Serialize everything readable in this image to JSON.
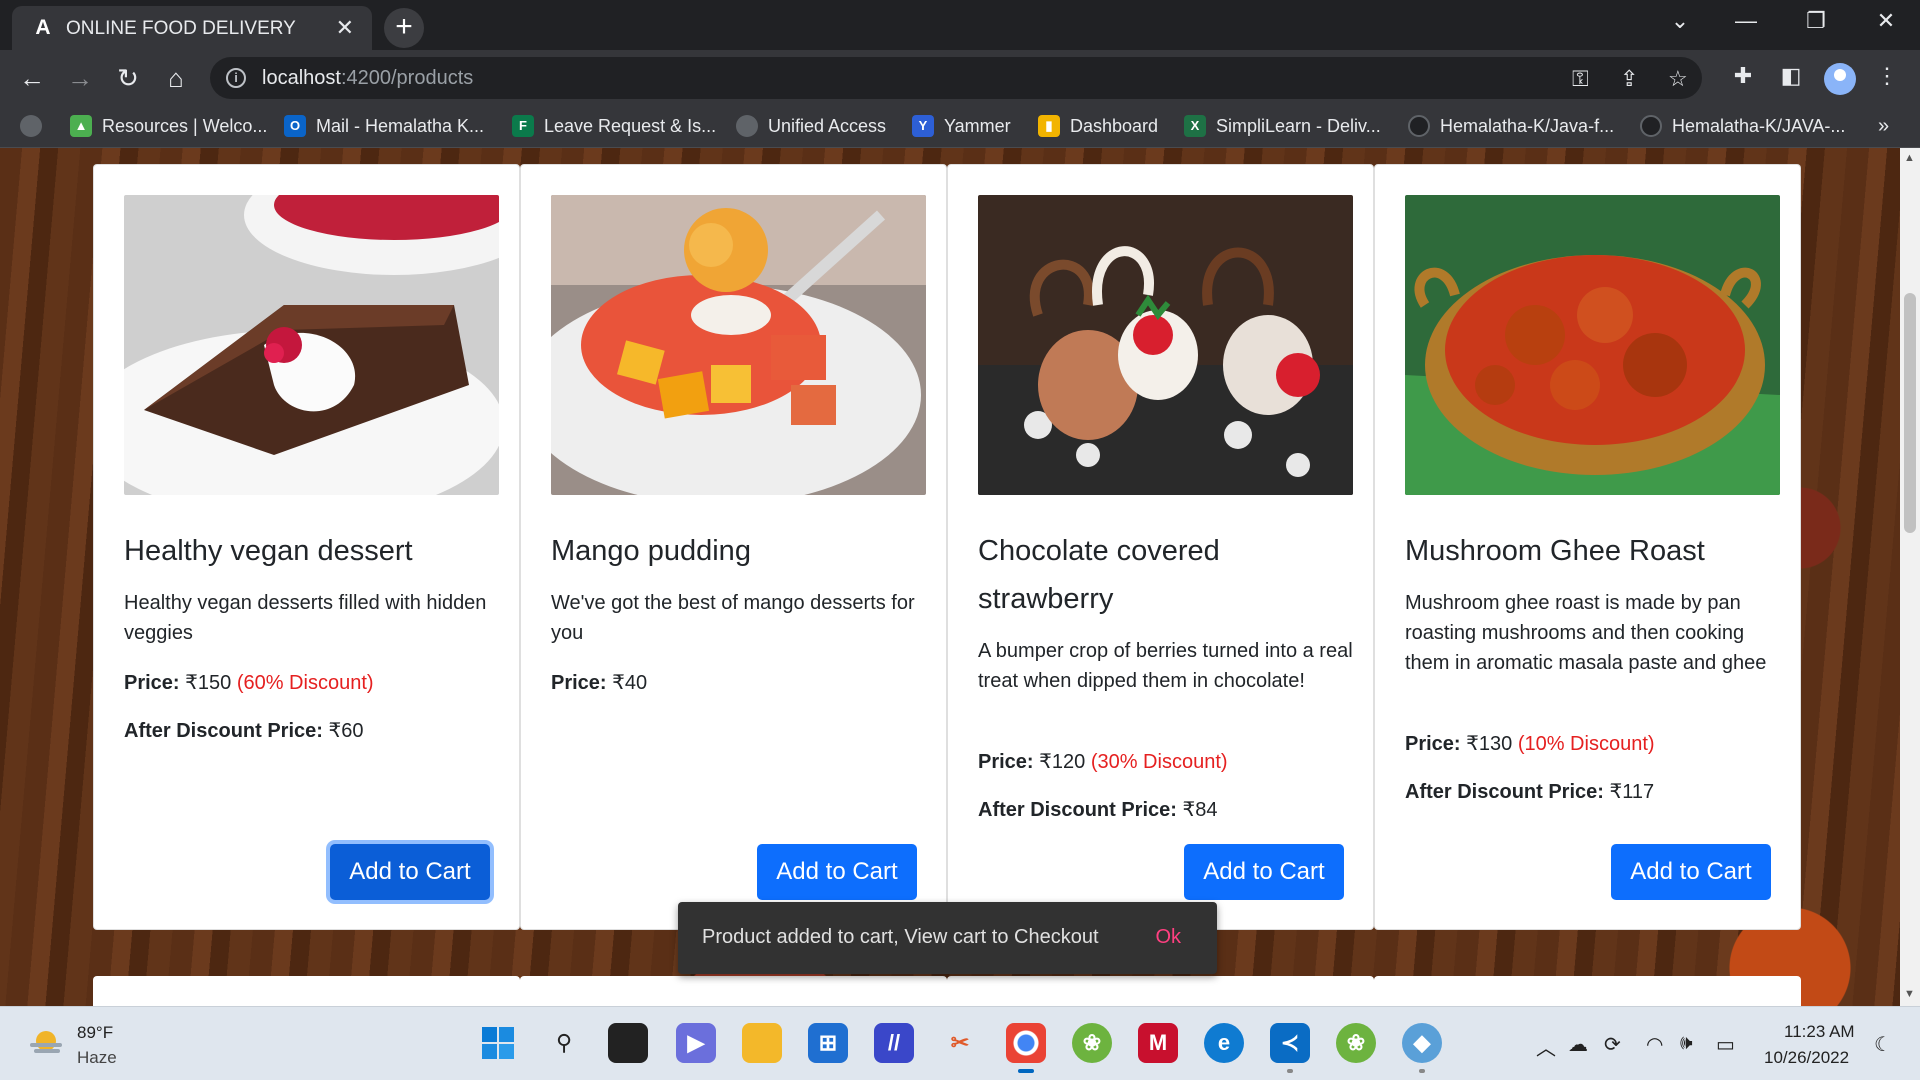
{
  "browser": {
    "tab_title": "ONLINE FOOD DELIVERY",
    "url_host": "localhost",
    "url_path": ":4200/products"
  },
  "bookmarks": [
    {
      "label": "Resources | Welco...",
      "icon": "building-icon",
      "color": "#4caf50"
    },
    {
      "label": "Mail - Hemalatha K...",
      "icon": "outlook-icon",
      "color": "#0a64c8"
    },
    {
      "label": "Leave Request & Is...",
      "icon": "forms-icon",
      "color": "#0b7a4b"
    },
    {
      "label": "Unified Access",
      "icon": "globe-icon",
      "color": "#5f6368"
    },
    {
      "label": "Yammer",
      "icon": "yammer-icon",
      "color": "#2d5fd6"
    },
    {
      "label": "Dashboard",
      "icon": "chart-icon",
      "color": "#f2b400"
    },
    {
      "label": "SimpliLearn - Deliv...",
      "icon": "excel-icon",
      "color": "#1e7145"
    },
    {
      "label": "Hemalatha-K/Java-f...",
      "icon": "github-icon",
      "color": "#202124"
    },
    {
      "label": "Hemalatha-K/JAVA-...",
      "icon": "github-icon",
      "color": "#202124"
    }
  ],
  "products": [
    {
      "name": "Healthy vegan dessert",
      "description": "Healthy vegan desserts filled with hidden veggies",
      "price_label": "Price:",
      "price": "₹150",
      "discount": "(60% Discount)",
      "after_label": "After Discount Price:",
      "after_price": "₹60",
      "button": "Add to Cart"
    },
    {
      "name": "Mango pudding",
      "description": "We've got the best of mango desserts for you",
      "price_label": "Price:",
      "price": "₹40",
      "button": "Add to Cart"
    },
    {
      "name": "Chocolate covered strawberry",
      "description": "A bumper crop of berries turned into a real treat when dipped them in chocolate!",
      "price_label": "Price:",
      "price": "₹120",
      "discount": "(30% Discount)",
      "after_label": "After Discount Price:",
      "after_price": "₹84",
      "button": "Add to Cart"
    },
    {
      "name": "Mushroom Ghee Roast",
      "description": "Mushroom ghee roast is made by pan roasting mushrooms and then cooking them in aromatic masala paste and ghee",
      "price_label": "Price:",
      "price": "₹130",
      "discount": "(10% Discount)",
      "after_label": "After Discount Price:",
      "after_price": "₹117",
      "button": "Add to Cart"
    }
  ],
  "snackbar": {
    "message": "Product added to cart, View cart to Checkout",
    "action": "Ok"
  },
  "taskbar": {
    "temperature": "89°F",
    "weather": "Haze",
    "time": "11:23 AM",
    "date": "10/26/2022"
  },
  "colors": {
    "primary": "#0d6efd",
    "discount": "#e52020",
    "snackbar_action": "#ff4081"
  }
}
